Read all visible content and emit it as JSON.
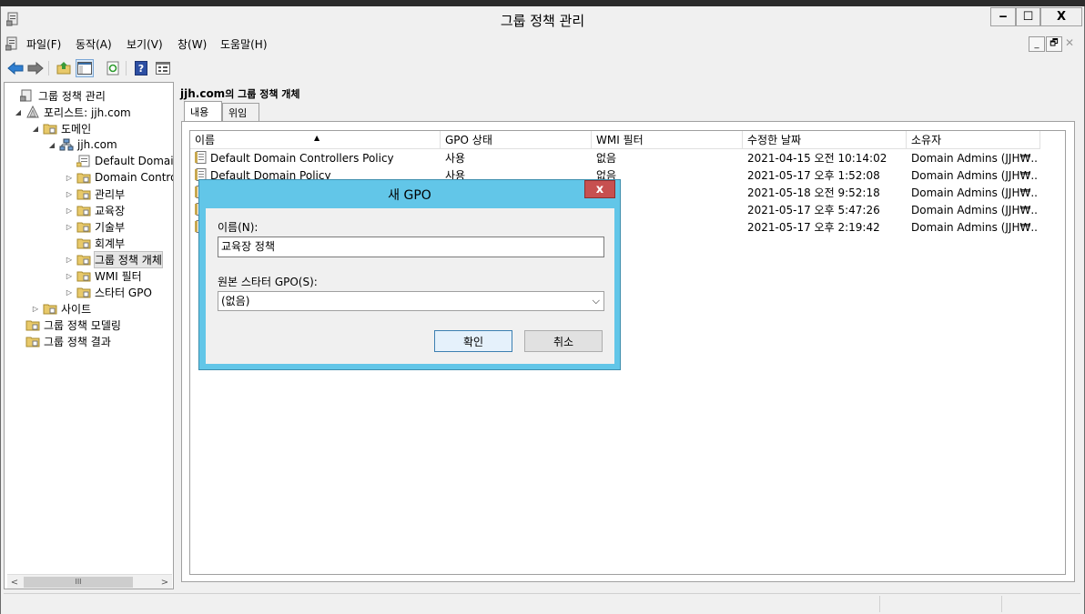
{
  "window": {
    "title": "그룹 정책 관리",
    "controls": {
      "minimize": "‒",
      "maximize": "☐",
      "close": "X"
    }
  },
  "menu": [
    "파일(F)",
    "동작(A)",
    "보기(V)",
    "창(W)",
    "도움말(H)"
  ],
  "toolbar": {
    "icons": [
      "back-arrow-icon",
      "forward-arrow-icon",
      "up-folder-icon",
      "show-hide-tree-icon",
      "refresh-icon",
      "help-icon",
      "properties-icon"
    ]
  },
  "tree": [
    {
      "label": "그룹 정책 관리",
      "icon": "gpm-icon",
      "level": 0,
      "expander": ""
    },
    {
      "label": "포리스트: jjh.com",
      "icon": "forest-icon",
      "level": 1,
      "expander": "◢"
    },
    {
      "label": "도메인",
      "icon": "domains-folder-icon",
      "level": 2,
      "expander": "◢"
    },
    {
      "label": "jjh.com",
      "icon": "domain-icon",
      "level": 3,
      "expander": "◢"
    },
    {
      "label": "Default Domain Policy",
      "icon": "gpo-link-icon",
      "level": 4,
      "expander": ""
    },
    {
      "label": "Domain Controllers",
      "icon": "ou-folder-icon",
      "level": 4,
      "expander": "▷"
    },
    {
      "label": "관리부",
      "icon": "ou-folder-icon",
      "level": 4,
      "expander": "▷"
    },
    {
      "label": "교육장",
      "icon": "ou-folder-icon",
      "level": 4,
      "expander": "▷"
    },
    {
      "label": "기술부",
      "icon": "ou-folder-icon",
      "level": 4,
      "expander": "▷"
    },
    {
      "label": "회계부",
      "icon": "ou-folder-icon",
      "level": 4,
      "expander": ""
    },
    {
      "label": "그룹 정책 개체",
      "icon": "gpo-container-icon",
      "level": 4,
      "expander": "▷",
      "selected": true
    },
    {
      "label": "WMI 필터",
      "icon": "wmi-filter-icon",
      "level": 4,
      "expander": "▷"
    },
    {
      "label": "스타터 GPO",
      "icon": "starter-gpo-icon",
      "level": 4,
      "expander": "▷"
    },
    {
      "label": "사이트",
      "icon": "sites-icon",
      "level": 2,
      "expander": "▷"
    },
    {
      "label": "그룹 정책 모델링",
      "icon": "modeling-icon",
      "level": 1,
      "expander": ""
    },
    {
      "label": "그룹 정책 결과",
      "icon": "results-icon",
      "level": 1,
      "expander": ""
    }
  ],
  "tree_scroll": {
    "left": "<",
    "right": ">",
    "grip": "III"
  },
  "main": {
    "title_strong": "jjh.com",
    "title_suffix": "의 그룹 정책 개체",
    "tabs": [
      "내용",
      "위임"
    ],
    "columns": [
      "이름",
      "GPO 상태",
      "WMI 필터",
      "수정한 날짜",
      "소유자"
    ],
    "sort_indicator": "▲",
    "rows": [
      {
        "name": "Default Domain Controllers Policy",
        "status": "사용",
        "wmi": "없음",
        "modified": "2021-04-15 오전 10:14:02",
        "owner": "Domain Admins (JJH₩..."
      },
      {
        "name": "Default Domain Policy",
        "status": "사용",
        "wmi": "없음",
        "modified": "2021-05-17 오후 1:52:08",
        "owner": "Domain Admins (JJH₩..."
      },
      {
        "name": "",
        "status": "",
        "wmi": "",
        "modified": "2021-05-18 오전 9:52:18",
        "owner": "Domain Admins (JJH₩..."
      },
      {
        "name": "",
        "status": "",
        "wmi": "",
        "modified": "2021-05-17 오후 5:47:26",
        "owner": "Domain Admins (JJH₩..."
      },
      {
        "name": "",
        "status": "",
        "wmi": "",
        "modified": "2021-05-17 오후 2:19:42",
        "owner": "Domain Admins (JJH₩..."
      }
    ]
  },
  "dialog": {
    "title": "새 GPO",
    "close": "x",
    "name_label": "이름(N):",
    "name_value": "교육장 정책",
    "starter_label": "원본 스타터 GPO(S):",
    "starter_value": "(없음)",
    "ok_label": "확인",
    "cancel_label": "취소"
  },
  "colors": {
    "dialog_frame": "#62c6e8",
    "close_button": "#c75050",
    "background": "#f0f0f0"
  }
}
